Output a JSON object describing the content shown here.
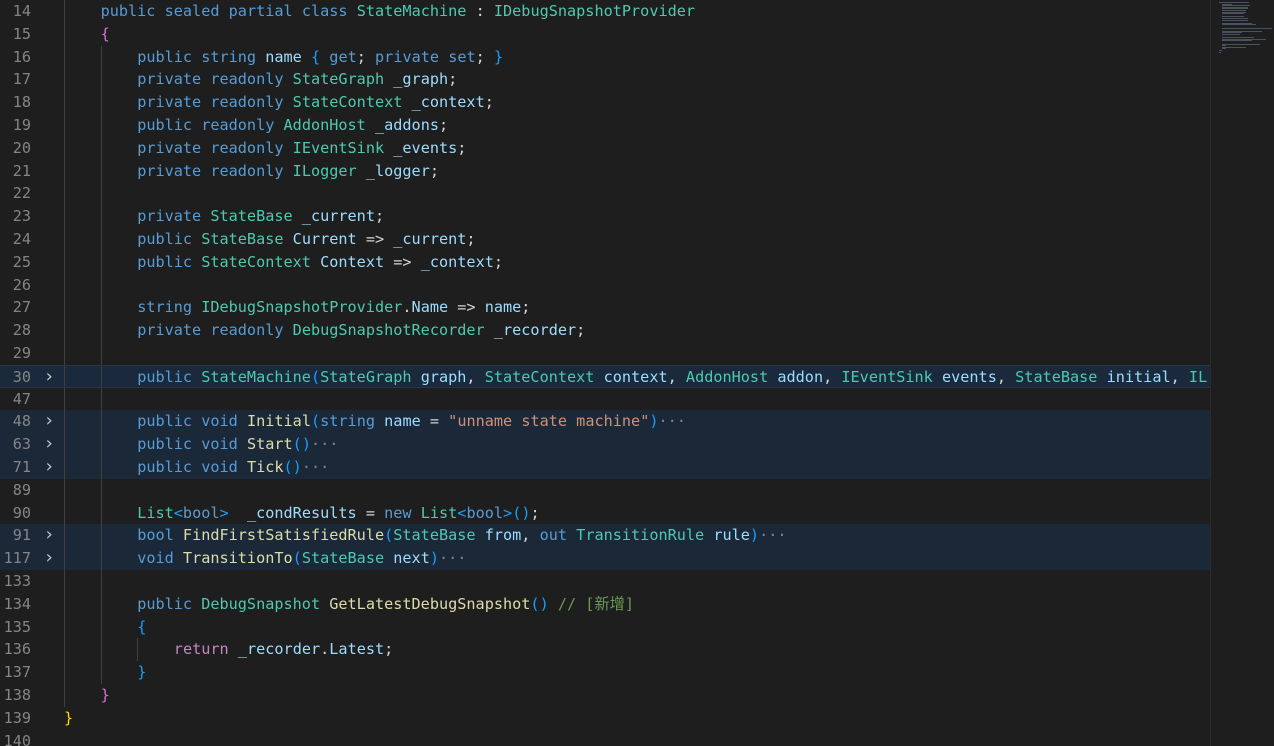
{
  "editor": {
    "lines": [
      {
        "n": "14",
        "fold": false,
        "hl": false,
        "indent": 1,
        "tokens": [
          [
            "k",
            "public"
          ],
          [
            "p",
            " "
          ],
          [
            "k",
            "sealed"
          ],
          [
            "p",
            " "
          ],
          [
            "k",
            "partial"
          ],
          [
            "p",
            " "
          ],
          [
            "k",
            "class"
          ],
          [
            "p",
            " "
          ],
          [
            "t",
            "StateMachine"
          ],
          [
            "p",
            " : "
          ],
          [
            "t",
            "IDebugSnapshotProvider"
          ]
        ]
      },
      {
        "n": "15",
        "fold": false,
        "hl": false,
        "indent": 1,
        "tokens": [
          [
            "b2",
            "{"
          ]
        ]
      },
      {
        "n": "16",
        "fold": false,
        "hl": false,
        "indent": 2,
        "tokens": [
          [
            "k",
            "public"
          ],
          [
            "p",
            " "
          ],
          [
            "k",
            "string"
          ],
          [
            "p",
            " "
          ],
          [
            "v",
            "name"
          ],
          [
            "p",
            " "
          ],
          [
            "b3",
            "{"
          ],
          [
            "p",
            " "
          ],
          [
            "k",
            "get"
          ],
          [
            "p",
            "; "
          ],
          [
            "k",
            "private"
          ],
          [
            "p",
            " "
          ],
          [
            "k",
            "set"
          ],
          [
            "p",
            "; "
          ],
          [
            "b3",
            "}"
          ]
        ]
      },
      {
        "n": "17",
        "fold": false,
        "hl": false,
        "indent": 2,
        "tokens": [
          [
            "k",
            "private"
          ],
          [
            "p",
            " "
          ],
          [
            "k",
            "readonly"
          ],
          [
            "p",
            " "
          ],
          [
            "t",
            "StateGraph"
          ],
          [
            "p",
            " "
          ],
          [
            "v",
            "_graph"
          ],
          [
            "p",
            ";"
          ]
        ]
      },
      {
        "n": "18",
        "fold": false,
        "hl": false,
        "indent": 2,
        "tokens": [
          [
            "k",
            "private"
          ],
          [
            "p",
            " "
          ],
          [
            "k",
            "readonly"
          ],
          [
            "p",
            " "
          ],
          [
            "t",
            "StateContext"
          ],
          [
            "p",
            " "
          ],
          [
            "v",
            "_context"
          ],
          [
            "p",
            ";"
          ]
        ]
      },
      {
        "n": "19",
        "fold": false,
        "hl": false,
        "indent": 2,
        "tokens": [
          [
            "k",
            "public"
          ],
          [
            "p",
            " "
          ],
          [
            "k",
            "readonly"
          ],
          [
            "p",
            " "
          ],
          [
            "t",
            "AddonHost"
          ],
          [
            "p",
            " "
          ],
          [
            "v",
            "_addons"
          ],
          [
            "p",
            ";"
          ]
        ]
      },
      {
        "n": "20",
        "fold": false,
        "hl": false,
        "indent": 2,
        "tokens": [
          [
            "k",
            "private"
          ],
          [
            "p",
            " "
          ],
          [
            "k",
            "readonly"
          ],
          [
            "p",
            " "
          ],
          [
            "t",
            "IEventSink"
          ],
          [
            "p",
            " "
          ],
          [
            "v",
            "_events"
          ],
          [
            "p",
            ";"
          ]
        ]
      },
      {
        "n": "21",
        "fold": false,
        "hl": false,
        "indent": 2,
        "tokens": [
          [
            "k",
            "private"
          ],
          [
            "p",
            " "
          ],
          [
            "k",
            "readonly"
          ],
          [
            "p",
            " "
          ],
          [
            "t",
            "ILogger"
          ],
          [
            "p",
            " "
          ],
          [
            "v",
            "_logger"
          ],
          [
            "p",
            ";"
          ]
        ]
      },
      {
        "n": "22",
        "fold": false,
        "hl": false,
        "indent": 2,
        "tokens": []
      },
      {
        "n": "23",
        "fold": false,
        "hl": false,
        "indent": 2,
        "tokens": [
          [
            "k",
            "private"
          ],
          [
            "p",
            " "
          ],
          [
            "t",
            "StateBase"
          ],
          [
            "p",
            " "
          ],
          [
            "v",
            "_current"
          ],
          [
            "p",
            ";"
          ]
        ]
      },
      {
        "n": "24",
        "fold": false,
        "hl": false,
        "indent": 2,
        "tokens": [
          [
            "k",
            "public"
          ],
          [
            "p",
            " "
          ],
          [
            "t",
            "StateBase"
          ],
          [
            "p",
            " "
          ],
          [
            "v",
            "Current"
          ],
          [
            "p",
            " => "
          ],
          [
            "v",
            "_current"
          ],
          [
            "p",
            ";"
          ]
        ]
      },
      {
        "n": "25",
        "fold": false,
        "hl": false,
        "indent": 2,
        "tokens": [
          [
            "k",
            "public"
          ],
          [
            "p",
            " "
          ],
          [
            "t",
            "StateContext"
          ],
          [
            "p",
            " "
          ],
          [
            "v",
            "Context"
          ],
          [
            "p",
            " => "
          ],
          [
            "v",
            "_context"
          ],
          [
            "p",
            ";"
          ]
        ]
      },
      {
        "n": "26",
        "fold": false,
        "hl": false,
        "indent": 2,
        "tokens": []
      },
      {
        "n": "27",
        "fold": false,
        "hl": false,
        "indent": 2,
        "tokens": [
          [
            "k",
            "string"
          ],
          [
            "p",
            " "
          ],
          [
            "t",
            "IDebugSnapshotProvider"
          ],
          [
            "p",
            "."
          ],
          [
            "v",
            "Name"
          ],
          [
            "p",
            " => "
          ],
          [
            "v",
            "name"
          ],
          [
            "p",
            ";"
          ]
        ]
      },
      {
        "n": "28",
        "fold": false,
        "hl": false,
        "indent": 2,
        "tokens": [
          [
            "k",
            "private"
          ],
          [
            "p",
            " "
          ],
          [
            "k",
            "readonly"
          ],
          [
            "p",
            " "
          ],
          [
            "t",
            "DebugSnapshotRecorder"
          ],
          [
            "p",
            " "
          ],
          [
            "v",
            "_recorder"
          ],
          [
            "p",
            ";"
          ]
        ]
      },
      {
        "n": "29",
        "fold": false,
        "hl": false,
        "indent": 2,
        "tokens": []
      },
      {
        "n": "30",
        "fold": true,
        "hl": "cur",
        "indent": 2,
        "tokens": [
          [
            "k",
            "public"
          ],
          [
            "p",
            " "
          ],
          [
            "t",
            "StateMachine"
          ],
          [
            "b3",
            "("
          ],
          [
            "t",
            "StateGraph"
          ],
          [
            "p",
            " "
          ],
          [
            "v",
            "graph"
          ],
          [
            "p",
            ", "
          ],
          [
            "t",
            "StateContext"
          ],
          [
            "p",
            " "
          ],
          [
            "v",
            "context"
          ],
          [
            "p",
            ", "
          ],
          [
            "t",
            "AddonHost"
          ],
          [
            "p",
            " "
          ],
          [
            "v",
            "addon"
          ],
          [
            "p",
            ", "
          ],
          [
            "t",
            "IEventSink"
          ],
          [
            "p",
            " "
          ],
          [
            "v",
            "events"
          ],
          [
            "p",
            ", "
          ],
          [
            "t",
            "StateBase"
          ],
          [
            "p",
            " "
          ],
          [
            "v",
            "initial"
          ],
          [
            "p",
            ", "
          ],
          [
            "t",
            "IL"
          ]
        ]
      },
      {
        "n": "47",
        "fold": false,
        "hl": false,
        "indent": 2,
        "tokens": []
      },
      {
        "n": "48",
        "fold": true,
        "hl": true,
        "indent": 2,
        "tokens": [
          [
            "k",
            "public"
          ],
          [
            "p",
            " "
          ],
          [
            "k",
            "void"
          ],
          [
            "p",
            " "
          ],
          [
            "f",
            "Initial"
          ],
          [
            "b3",
            "("
          ],
          [
            "k",
            "string"
          ],
          [
            "p",
            " "
          ],
          [
            "v",
            "name"
          ],
          [
            "p",
            " = "
          ],
          [
            "s",
            "\"unname state machine\""
          ],
          [
            "b3",
            ")"
          ],
          [
            "dots",
            "···"
          ]
        ]
      },
      {
        "n": "63",
        "fold": true,
        "hl": true,
        "indent": 2,
        "tokens": [
          [
            "k",
            "public"
          ],
          [
            "p",
            " "
          ],
          [
            "k",
            "void"
          ],
          [
            "p",
            " "
          ],
          [
            "f",
            "Start"
          ],
          [
            "b3",
            "()"
          ],
          [
            "dots",
            "···"
          ]
        ]
      },
      {
        "n": "71",
        "fold": true,
        "hl": true,
        "indent": 2,
        "tokens": [
          [
            "k",
            "public"
          ],
          [
            "p",
            " "
          ],
          [
            "k",
            "void"
          ],
          [
            "p",
            " "
          ],
          [
            "f",
            "Tick"
          ],
          [
            "b3",
            "()"
          ],
          [
            "dots",
            "···"
          ]
        ]
      },
      {
        "n": "89",
        "fold": false,
        "hl": false,
        "indent": 2,
        "tokens": []
      },
      {
        "n": "90",
        "fold": false,
        "hl": false,
        "indent": 2,
        "tokens": [
          [
            "t",
            "List"
          ],
          [
            "b3",
            "<"
          ],
          [
            "k",
            "bool"
          ],
          [
            "b3",
            ">"
          ],
          [
            "p",
            "  "
          ],
          [
            "v",
            "_condResults"
          ],
          [
            "p",
            " = "
          ],
          [
            "k",
            "new"
          ],
          [
            "p",
            " "
          ],
          [
            "t",
            "List"
          ],
          [
            "b3",
            "<"
          ],
          [
            "k",
            "bool"
          ],
          [
            "b3",
            ">"
          ],
          [
            "b3",
            "()"
          ],
          [
            "p",
            ";"
          ]
        ]
      },
      {
        "n": "91",
        "fold": true,
        "hl": true,
        "indent": 2,
        "tokens": [
          [
            "k",
            "bool"
          ],
          [
            "p",
            " "
          ],
          [
            "f",
            "FindFirstSatisfiedRule"
          ],
          [
            "b3",
            "("
          ],
          [
            "t",
            "StateBase"
          ],
          [
            "p",
            " "
          ],
          [
            "v",
            "from"
          ],
          [
            "p",
            ", "
          ],
          [
            "k",
            "out"
          ],
          [
            "p",
            " "
          ],
          [
            "t",
            "TransitionRule"
          ],
          [
            "p",
            " "
          ],
          [
            "v",
            "rule"
          ],
          [
            "b3",
            ")"
          ],
          [
            "dots",
            "···"
          ]
        ]
      },
      {
        "n": "117",
        "fold": true,
        "hl": true,
        "indent": 2,
        "tokens": [
          [
            "k",
            "void"
          ],
          [
            "p",
            " "
          ],
          [
            "f",
            "TransitionTo"
          ],
          [
            "b3",
            "("
          ],
          [
            "t",
            "StateBase"
          ],
          [
            "p",
            " "
          ],
          [
            "v",
            "next"
          ],
          [
            "b3",
            ")"
          ],
          [
            "dots",
            "···"
          ]
        ]
      },
      {
        "n": "133",
        "fold": false,
        "hl": false,
        "indent": 2,
        "tokens": []
      },
      {
        "n": "134",
        "fold": false,
        "hl": false,
        "indent": 2,
        "tokens": [
          [
            "k",
            "public"
          ],
          [
            "p",
            " "
          ],
          [
            "t",
            "DebugSnapshot"
          ],
          [
            "p",
            " "
          ],
          [
            "f",
            "GetLatestDebugSnapshot"
          ],
          [
            "b3",
            "()"
          ],
          [
            "p",
            " "
          ],
          [
            "cm",
            "// [新增]"
          ]
        ]
      },
      {
        "n": "135",
        "fold": false,
        "hl": false,
        "indent": 2,
        "tokens": [
          [
            "b3",
            "{"
          ]
        ]
      },
      {
        "n": "136",
        "fold": false,
        "hl": false,
        "indent": 3,
        "tokens": [
          [
            "c",
            "return"
          ],
          [
            "p",
            " "
          ],
          [
            "v",
            "_recorder"
          ],
          [
            "p",
            "."
          ],
          [
            "v",
            "Latest"
          ],
          [
            "p",
            ";"
          ]
        ]
      },
      {
        "n": "137",
        "fold": false,
        "hl": false,
        "indent": 2,
        "tokens": [
          [
            "b3",
            "}"
          ]
        ]
      },
      {
        "n": "138",
        "fold": false,
        "hl": false,
        "indent": 1,
        "tokens": [
          [
            "b2",
            "}"
          ]
        ]
      },
      {
        "n": "139",
        "fold": false,
        "hl": false,
        "indent": 0,
        "tokens": [
          [
            "b1",
            "}"
          ]
        ]
      },
      {
        "n": "140",
        "fold": false,
        "hl": false,
        "indent": 0,
        "tokens": []
      }
    ]
  },
  "minimap": {
    "label": "minimap"
  }
}
